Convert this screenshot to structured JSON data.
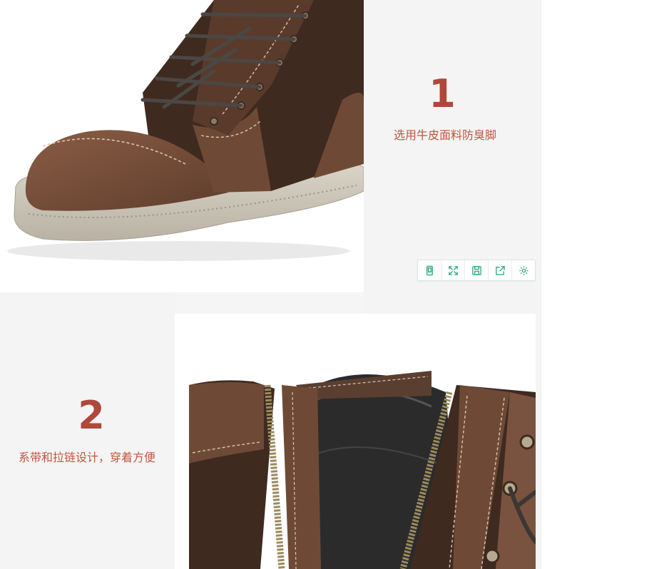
{
  "sections": [
    {
      "number": "1",
      "caption": "选用牛皮面料防臭脚"
    },
    {
      "number": "2",
      "caption": "系带和拉链设计，穿着方便"
    }
  ],
  "toolbar": [
    {
      "icon": "phone-icon"
    },
    {
      "icon": "expand-icon"
    },
    {
      "icon": "save-icon"
    },
    {
      "icon": "share-icon"
    },
    {
      "icon": "gear-icon"
    }
  ],
  "colors": {
    "accent": "#b0473a",
    "caption": "#c0563f",
    "toolbar_icon": "#2aa873",
    "leather": "#6e4a36",
    "suede": "#3f2a20",
    "sole": "#cfc9bd"
  }
}
